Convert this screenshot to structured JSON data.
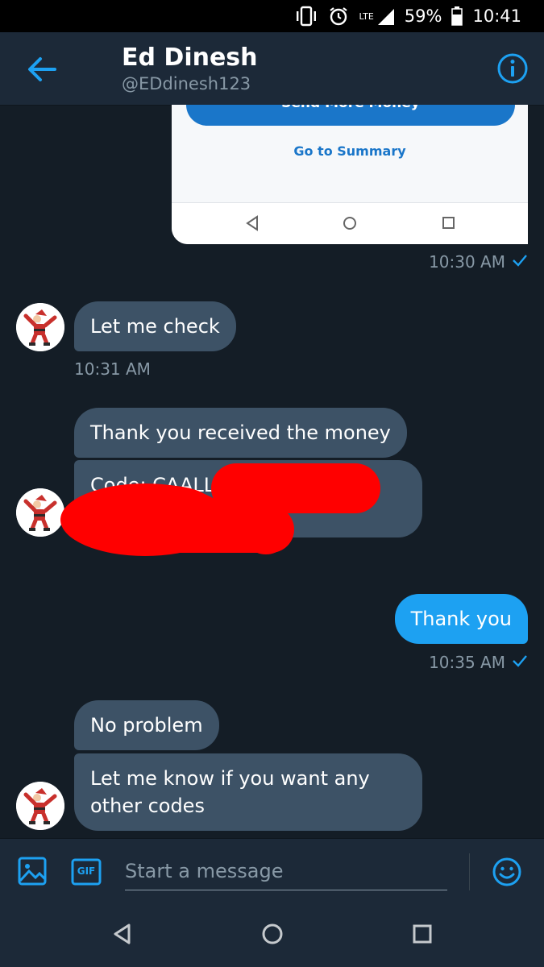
{
  "status_bar": {
    "network": "LTE",
    "battery": "59%",
    "time": "10:41"
  },
  "header": {
    "name": "Ed Dinesh",
    "handle": "@EDdinesh123",
    "back_icon": "arrow-left-icon",
    "info_icon": "info-circle-icon"
  },
  "shared_screenshot": {
    "primary_button": "Send More Money",
    "link": "Go to Summary"
  },
  "messages": [
    {
      "from": "other",
      "text": "Let me check",
      "time": "10:31 AM"
    },
    {
      "from": "other",
      "text": "Thank you received the money"
    },
    {
      "from": "other",
      "text": "Code: CAALL"
    },
    {
      "from": "me",
      "text": "Thank you",
      "time": "10:35 AM"
    },
    {
      "from": "other",
      "text": "No problem"
    },
    {
      "from": "other",
      "text": "Let me know if you want any other codes"
    }
  ],
  "first_sent_time": "10:30 AM",
  "composer": {
    "placeholder": "Start a message",
    "gif_label": "GIF"
  },
  "colors": {
    "background": "#141d26",
    "bar": "#1c2938",
    "accent": "#1da1f2",
    "received_bubble": "#3d5266",
    "muted_text": "#8899a6",
    "redaction": "#ff0000"
  }
}
